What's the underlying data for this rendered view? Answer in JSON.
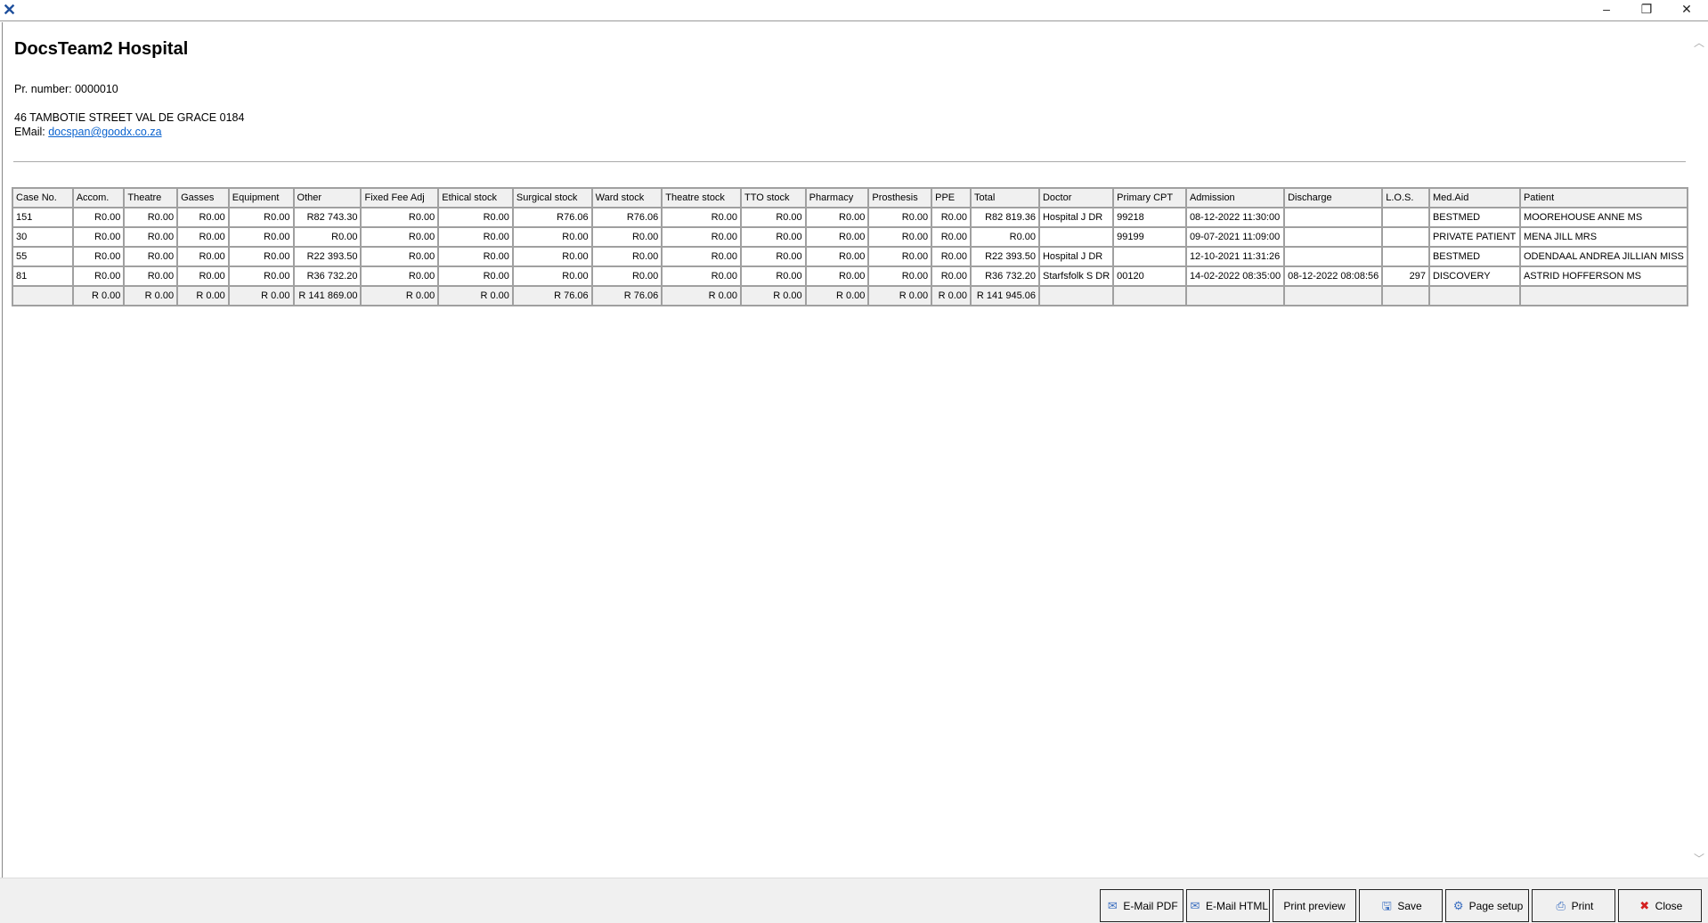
{
  "window": {
    "minimize": "–",
    "restore": "❐",
    "close": "✕"
  },
  "report": {
    "title": "DocsTeam2 Hospital",
    "pr_number": "Pr. number: 0000010",
    "address": "46 TAMBOTIE STREET VAL DE GRACE 0184",
    "email_label": "EMail: ",
    "email": "docspan@goodx.co.za"
  },
  "table": {
    "headers": [
      "Case No.",
      "Accom.",
      "Theatre",
      "Gasses",
      "Equipment",
      "Other",
      "Fixed Fee Adj",
      "Ethical stock",
      "Surgical stock",
      "Ward stock",
      "Theatre stock",
      "TTO stock",
      "Pharmacy",
      "Prosthesis",
      "PPE",
      "Total",
      "Doctor",
      "Primary CPT",
      "Admission",
      "Discharge",
      "L.O.S.",
      "Med.Aid",
      "Patient"
    ],
    "rows": [
      [
        "151",
        "R0.00",
        "R0.00",
        "R0.00",
        "R0.00",
        "R82 743.30",
        "R0.00",
        "R0.00",
        "R76.06",
        "R76.06",
        "R0.00",
        "R0.00",
        "R0.00",
        "R0.00",
        "R0.00",
        "R82 819.36",
        "Hospital J DR",
        "99218",
        "08-12-2022 11:30:00",
        "",
        "",
        "BESTMED",
        "MOOREHOUSE ANNE MS"
      ],
      [
        "30",
        "R0.00",
        "R0.00",
        "R0.00",
        "R0.00",
        "R0.00",
        "R0.00",
        "R0.00",
        "R0.00",
        "R0.00",
        "R0.00",
        "R0.00",
        "R0.00",
        "R0.00",
        "R0.00",
        "R0.00",
        "",
        "99199",
        "09-07-2021 11:09:00",
        "",
        "",
        "PRIVATE PATIENT",
        "MENA JILL MRS"
      ],
      [
        "55",
        "R0.00",
        "R0.00",
        "R0.00",
        "R0.00",
        "R22 393.50",
        "R0.00",
        "R0.00",
        "R0.00",
        "R0.00",
        "R0.00",
        "R0.00",
        "R0.00",
        "R0.00",
        "R0.00",
        "R22 393.50",
        "Hospital J DR",
        "",
        "12-10-2021 11:31:26",
        "",
        "",
        "BESTMED",
        "ODENDAAL ANDREA JILLIAN MISS"
      ],
      [
        "81",
        "R0.00",
        "R0.00",
        "R0.00",
        "R0.00",
        "R36 732.20",
        "R0.00",
        "R0.00",
        "R0.00",
        "R0.00",
        "R0.00",
        "R0.00",
        "R0.00",
        "R0.00",
        "R0.00",
        "R36 732.20",
        "Starfsfolk S DR",
        "00120",
        "14-02-2022 08:35:00",
        "08-12-2022 08:08:56",
        "297",
        "DISCOVERY",
        "ASTRID HOFFERSON MS"
      ]
    ],
    "totals": [
      "",
      "R 0.00",
      "R 0.00",
      "R 0.00",
      "R 0.00",
      "R 141 869.00",
      "R 0.00",
      "R 0.00",
      "R 76.06",
      "R 76.06",
      "R 0.00",
      "R 0.00",
      "R 0.00",
      "R 0.00",
      "R 0.00",
      "R 141 945.06",
      "",
      "",
      "",
      "",
      "",
      "",
      ""
    ]
  },
  "buttons": [
    {
      "label": "E-Mail PDF",
      "icon": "email-icon",
      "glyph": "✉"
    },
    {
      "label": "E-Mail HTML",
      "icon": "email-icon",
      "glyph": "✉"
    },
    {
      "label": "Print preview",
      "icon": "",
      "glyph": ""
    },
    {
      "label": "Save",
      "icon": "save-icon",
      "glyph": "🖫"
    },
    {
      "label": "Page setup",
      "icon": "page-setup-icon",
      "glyph": "⚙"
    },
    {
      "label": "Print",
      "icon": "printer-icon",
      "glyph": "⎙"
    },
    {
      "label": "Close",
      "icon": "close-icon",
      "glyph": "✖"
    }
  ]
}
